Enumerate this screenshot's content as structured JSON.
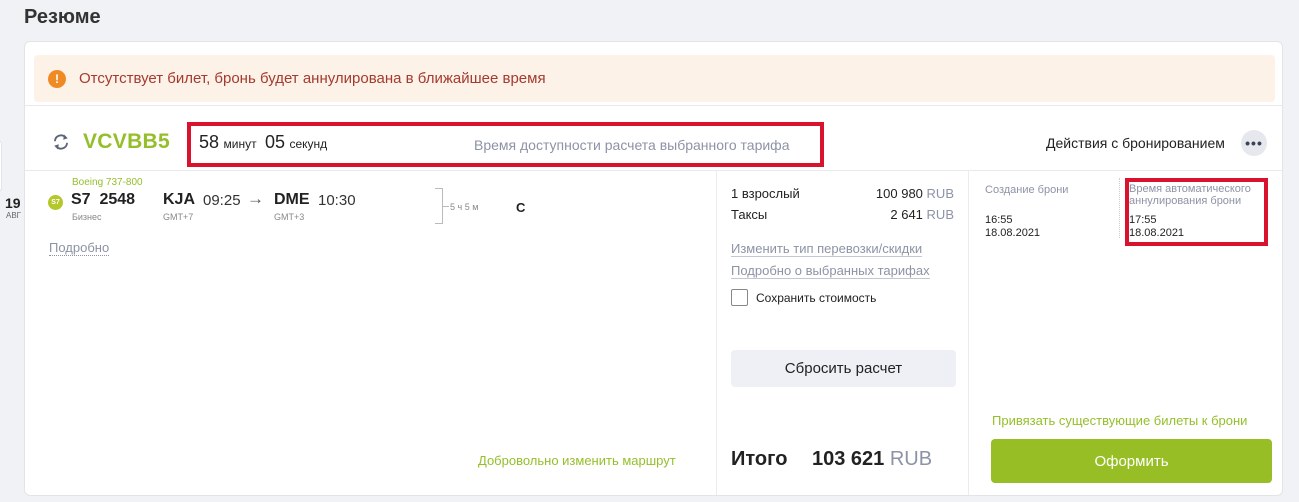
{
  "page": {
    "title": "Резюме"
  },
  "alert": {
    "icon": "!",
    "text": "Отсутствует билет, бронь будет аннулирована в ближайшее время"
  },
  "booking": {
    "pnr": "VCVBB5",
    "timer": {
      "minutes": "58",
      "minutes_unit": "минут",
      "seconds": "05",
      "seconds_unit": "секунд"
    },
    "timer_label": "Время доступности расчета выбранного тарифа",
    "actions_label": "Действия с бронированием",
    "more_label": "•••"
  },
  "flight": {
    "date_day": "19",
    "date_month": "АВГ",
    "aircraft": "Boeing 737-800",
    "airline_logo": "S7",
    "flight_code": "S7  2548",
    "cabin": "Бизнес",
    "departure": {
      "code": "KJA",
      "time": "09:25",
      "tz": "GMT+7"
    },
    "arrow": "→",
    "arrival": {
      "code": "DME",
      "time": "10:30",
      "tz": "GMT+3"
    },
    "duration": "5 ч 5 м",
    "fare_class": "C",
    "details_link": "Подробно",
    "change_route_link": "Добровольно изменить маршрут"
  },
  "pricing": {
    "passengers_label": "1 взрослый",
    "passengers_amount": "100 980",
    "taxes_label": "Таксы",
    "taxes_amount": "2 641",
    "currency": "RUB",
    "change_transport_link": "Изменить тип перевозки/скидки",
    "fare_details_link": "Подробно о выбранных тарифах",
    "save_cost_label": "Сохранить стоимость",
    "save_cost_checked": false,
    "reset_button": "Сбросить расчет",
    "total_label": "Итого",
    "total_amount": "103 621",
    "total_currency": "RUB"
  },
  "status": {
    "created_label": "Создание брони",
    "created_time": "16:55",
    "created_date": "18.08.2021",
    "auto_cancel_label": "Время автоматического аннулирования брони",
    "auto_cancel_time": "17:55",
    "auto_cancel_date": "18.08.2021",
    "bind_tickets_link": "Привязать существующие билеты к брони",
    "submit_button": "Оформить"
  },
  "colors": {
    "accent_green": "#97bf25",
    "alert_bg": "#fdf2e7",
    "alert_text": "#a43a30",
    "highlight_red": "#d9132d",
    "muted_text": "#8d93a6"
  }
}
